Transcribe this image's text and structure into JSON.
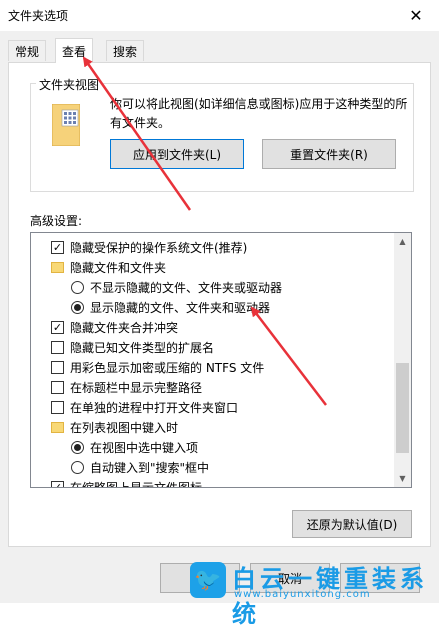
{
  "window": {
    "title": "文件夹选项",
    "close_glyph": "✕"
  },
  "tabs": [
    {
      "label": "常规",
      "active": false
    },
    {
      "label": "查看",
      "active": true
    },
    {
      "label": "搜索",
      "active": false
    }
  ],
  "folder_views": {
    "title": "文件夹视图",
    "description": "你可以将此视图(如详细信息或图标)应用于这种类型的所有文件夹。",
    "apply_button": "应用到文件夹(L)",
    "reset_button": "重置文件夹(R)"
  },
  "advanced": {
    "label": "高级设置:",
    "items": [
      {
        "type": "checkbox",
        "checked": true,
        "label": "隐藏受保护的操作系统文件(推荐)",
        "indent": 0
      },
      {
        "type": "folder",
        "label": "隐藏文件和文件夹",
        "indent": 0
      },
      {
        "type": "radio",
        "checked": false,
        "label": "不显示隐藏的文件、文件夹或驱动器",
        "indent": 1
      },
      {
        "type": "radio",
        "checked": true,
        "label": "显示隐藏的文件、文件夹和驱动器",
        "indent": 1
      },
      {
        "type": "checkbox",
        "checked": true,
        "label": "隐藏文件夹合并冲突",
        "indent": 0
      },
      {
        "type": "checkbox",
        "checked": false,
        "label": "隐藏已知文件类型的扩展名",
        "indent": 0
      },
      {
        "type": "checkbox",
        "checked": false,
        "label": "用彩色显示加密或压缩的 NTFS 文件",
        "indent": 0
      },
      {
        "type": "checkbox",
        "checked": false,
        "label": "在标题栏中显示完整路径",
        "indent": 0
      },
      {
        "type": "checkbox",
        "checked": false,
        "label": "在单独的进程中打开文件夹窗口",
        "indent": 0
      },
      {
        "type": "folder",
        "label": "在列表视图中键入时",
        "indent": 0
      },
      {
        "type": "radio",
        "checked": true,
        "label": "在视图中选中键入项",
        "indent": 1
      },
      {
        "type": "radio",
        "checked": false,
        "label": "自动键入到\"搜索\"框中",
        "indent": 1
      },
      {
        "type": "checkbox",
        "checked": true,
        "label": "在缩略图上显示文件图标",
        "indent": 0
      }
    ],
    "restore_button": "还原为默认值(D)"
  },
  "footer": {
    "cancel_button": "取消"
  },
  "watermark": {
    "brand": "白云一键重装系统",
    "url": "www.baiyunxitong.com",
    "logo_glyph": "🐦"
  },
  "colors": {
    "arrow": "#e8323a",
    "accent": "#0078d7",
    "watermark": "#1a9be6"
  }
}
